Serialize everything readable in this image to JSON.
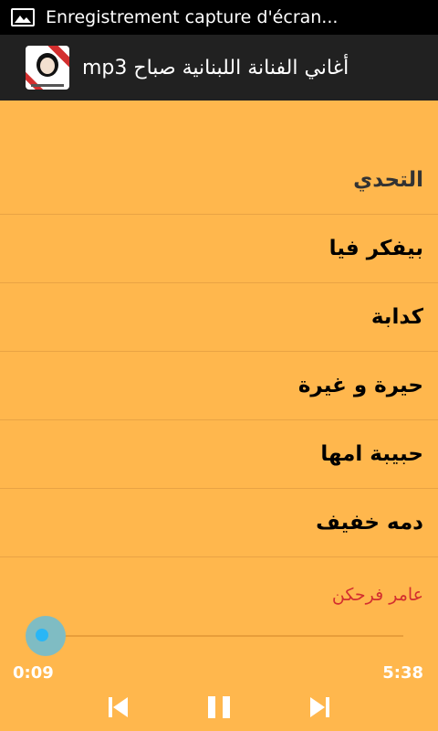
{
  "status_bar": {
    "notification_icon": "image-icon",
    "notification_text": "Enregistrement capture d'écran..."
  },
  "app_bar": {
    "title": "أغاني الفنانة اللبنانية صباح mp3",
    "icon": "app-logo-portrait"
  },
  "songs": [
    {
      "title": "التحدي"
    },
    {
      "title": "بيفكر فيا"
    },
    {
      "title": "كدابة"
    },
    {
      "title": "حيرة و غيرة"
    },
    {
      "title": "حبيبة امها"
    },
    {
      "title": "دمه خفيف"
    }
  ],
  "player": {
    "now_playing_artist": "عامر فرحكن",
    "current_time": "0:09",
    "total_time": "5:38",
    "progress": 0.03,
    "controls": [
      "previous-icon",
      "pause-icon",
      "next-icon"
    ],
    "accent_color": "#29B6F6"
  },
  "colors": {
    "background": "#FFB74D",
    "app_bar": "#212121",
    "artist_text": "#D32F2F"
  }
}
